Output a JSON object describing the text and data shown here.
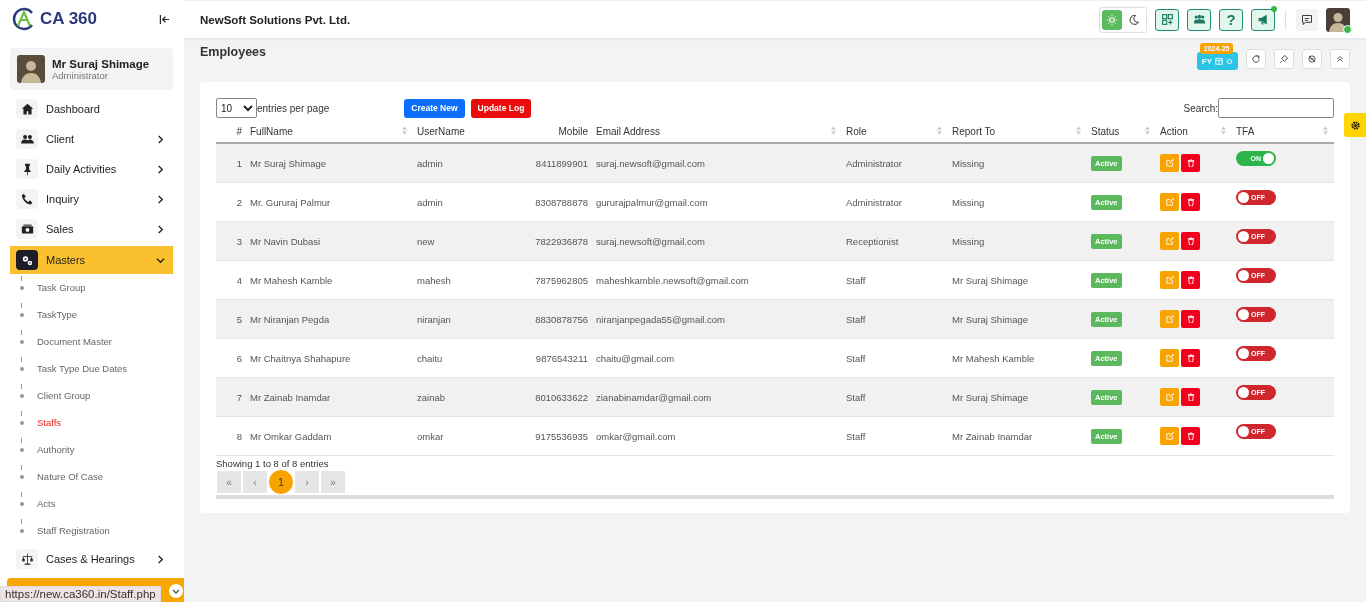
{
  "brand": {
    "logo_text": "CA 360"
  },
  "company": "NewSoft Solutions Pvt. Ltd.",
  "user": {
    "name": "Mr Suraj Shimage",
    "role": "Administrator",
    "online": true
  },
  "nav": [
    {
      "label": "Dashboard",
      "kind": "home",
      "expandable": false,
      "selected": false
    },
    {
      "label": "Client",
      "kind": "users",
      "expandable": true,
      "expanded": false,
      "selected": false
    },
    {
      "label": "Daily Activities",
      "kind": "pin",
      "expandable": true,
      "expanded": false,
      "selected": false
    },
    {
      "label": "Inquiry",
      "kind": "phone",
      "expandable": true,
      "expanded": false,
      "selected": false
    },
    {
      "label": "Sales",
      "kind": "money",
      "expandable": true,
      "expanded": false,
      "selected": false
    },
    {
      "label": "Masters",
      "kind": "gears",
      "expandable": true,
      "expanded": true,
      "selected": true,
      "children": [
        {
          "label": "Task Group",
          "selected": false
        },
        {
          "label": "TaskType",
          "selected": false
        },
        {
          "label": "Document Master",
          "selected": false
        },
        {
          "label": "Task Type Due Dates",
          "selected": false
        },
        {
          "label": "Client Group",
          "selected": false
        },
        {
          "label": "Staffs",
          "selected": true
        },
        {
          "label": "Authority",
          "selected": false
        },
        {
          "label": "Nature Of Case",
          "selected": false
        },
        {
          "label": "Acts",
          "selected": false
        },
        {
          "label": "Staff Registration",
          "selected": false
        }
      ]
    },
    {
      "label": "Cases & Hearings",
      "kind": "scales",
      "expandable": true,
      "expanded": false,
      "selected": false
    }
  ],
  "theme_toggle": [
    {
      "kind": "sun",
      "selected": true
    },
    {
      "kind": "moon",
      "selected": false
    }
  ],
  "header_buttons": [
    {
      "kind": "apps",
      "notification": false
    },
    {
      "kind": "users",
      "notification": false
    },
    {
      "kind": "help",
      "text": "?",
      "notification": false
    },
    {
      "kind": "announce",
      "notification": true
    }
  ],
  "page_title": "Employees",
  "fy": {
    "label": "FY",
    "badge": "2024-25"
  },
  "page_tools": [
    {
      "kind": "refresh"
    },
    {
      "kind": "pin"
    },
    {
      "kind": "hide"
    },
    {
      "kind": "collapse"
    }
  ],
  "table": {
    "page_length": "10",
    "length_label": "entries per page",
    "buttons": [
      {
        "label": "Create New",
        "kind": "primary"
      },
      {
        "label": "Update Log",
        "kind": "danger"
      }
    ],
    "search_label": "Search:",
    "columns": [
      {
        "label": "#",
        "sortable": false
      },
      {
        "label": "FullName",
        "sortable": true
      },
      {
        "label": "UserName",
        "sortable": false
      },
      {
        "label": "Mobile",
        "sortable": false
      },
      {
        "label": "Email Address",
        "sortable": true
      },
      {
        "label": "Role",
        "sortable": true
      },
      {
        "label": "Report To",
        "sortable": true
      },
      {
        "label": "Status",
        "sortable": true
      },
      {
        "label": "Action",
        "sortable": true
      },
      {
        "label": "TFA",
        "sortable": true
      }
    ],
    "rows": [
      {
        "index": "1",
        "name": "Mr Suraj Shimage",
        "username": "admin",
        "mobile": "8411899901",
        "email": "suraj.newsoft@gmail.com",
        "role": "Administrator",
        "report_to": "Missing",
        "status": "Active",
        "tfa": {
          "on": true,
          "label": "ON"
        }
      },
      {
        "index": "2",
        "name": "Mr. Gururaj Palmur",
        "username": "admin",
        "mobile": "8308788878",
        "email": "gururajpalmur@gmail.com",
        "role": "Administrator",
        "report_to": "Missing",
        "status": "Active",
        "tfa": {
          "on": false,
          "label": "OFF"
        }
      },
      {
        "index": "3",
        "name": "Mr Navin Dubasi",
        "username": "new",
        "mobile": "7822936878",
        "email": "suraj.newsoft@gmail.com",
        "role": "Receptionist",
        "report_to": "Missing",
        "status": "Active",
        "tfa": {
          "on": false,
          "label": "OFF"
        }
      },
      {
        "index": "4",
        "name": "Mr Mahesh Kamble",
        "username": "mahesh",
        "mobile": "7875962805",
        "email": "maheshkamble.newsoft@gmail.com",
        "role": "Staff",
        "report_to": "Mr Suraj Shimage",
        "status": "Active",
        "tfa": {
          "on": false,
          "label": "OFF"
        }
      },
      {
        "index": "5",
        "name": "Mr Niranjan Pegda",
        "username": "niranjan",
        "mobile": "8830878756",
        "email": "niranjanpegada55@gmail.com",
        "role": "Staff",
        "report_to": "Mr Suraj Shimage",
        "status": "Active",
        "tfa": {
          "on": false,
          "label": "OFF"
        }
      },
      {
        "index": "6",
        "name": "Mr Chaitnya Shahapure",
        "username": "chaitu",
        "mobile": "9876543211",
        "email": "chaitu@gmail.com",
        "role": "Staff",
        "report_to": "Mr Mahesh Kamble",
        "status": "Active",
        "tfa": {
          "on": false,
          "label": "OFF"
        }
      },
      {
        "index": "7",
        "name": "Mr Zainab Inamdar",
        "username": "zainab",
        "mobile": "8010633622",
        "email": "zianabinamdar@gmail.com",
        "role": "Staff",
        "report_to": "Mr Suraj Shimage",
        "status": "Active",
        "tfa": {
          "on": false,
          "label": "OFF"
        }
      },
      {
        "index": "8",
        "name": "Mr Omkar Gaddam",
        "username": "omkar",
        "mobile": "9175536935",
        "email": "omkar@gmail.com",
        "role": "Staff",
        "report_to": "Mr Zainab Inamdar",
        "status": "Active",
        "tfa": {
          "on": false,
          "label": "OFF"
        }
      }
    ],
    "info": "Showing 1 to 8 of 8 entries",
    "pagination": [
      {
        "label": "«",
        "selected": false,
        "disabled": true
      },
      {
        "label": "‹",
        "selected": false,
        "disabled": true
      },
      {
        "label": "1",
        "selected": true,
        "disabled": false
      },
      {
        "label": "›",
        "selected": false,
        "disabled": true
      },
      {
        "label": "»",
        "selected": false,
        "disabled": true
      }
    ]
  },
  "status_url": "https://new.ca360.in/Staff.php"
}
